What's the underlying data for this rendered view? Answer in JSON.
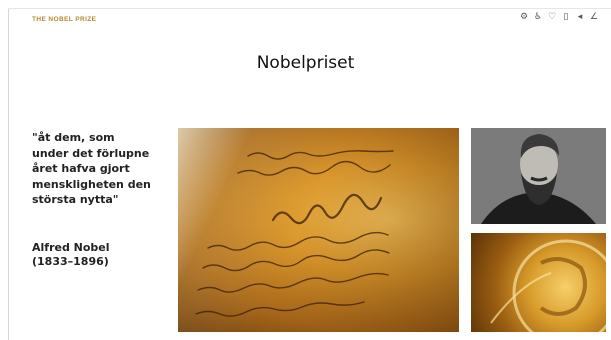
{
  "header": {
    "brand": "THE NOBEL PRIZE",
    "icons": [
      "gear-icon",
      "accessibility-icon",
      "heart-icon",
      "book-icon",
      "audio-icon",
      "chart-icon"
    ]
  },
  "page": {
    "title": "Nobelpriset"
  },
  "quote": {
    "text": "\"åt dem, som under det förlupne året hafva gjort menskligheten den största nytta\"",
    "author": "Alfred Nobel",
    "years": "(1833–1896)"
  },
  "images": {
    "main": "testament-manuscript",
    "portrait": "alfred-nobel-portrait",
    "medal": "nobel-medal"
  }
}
